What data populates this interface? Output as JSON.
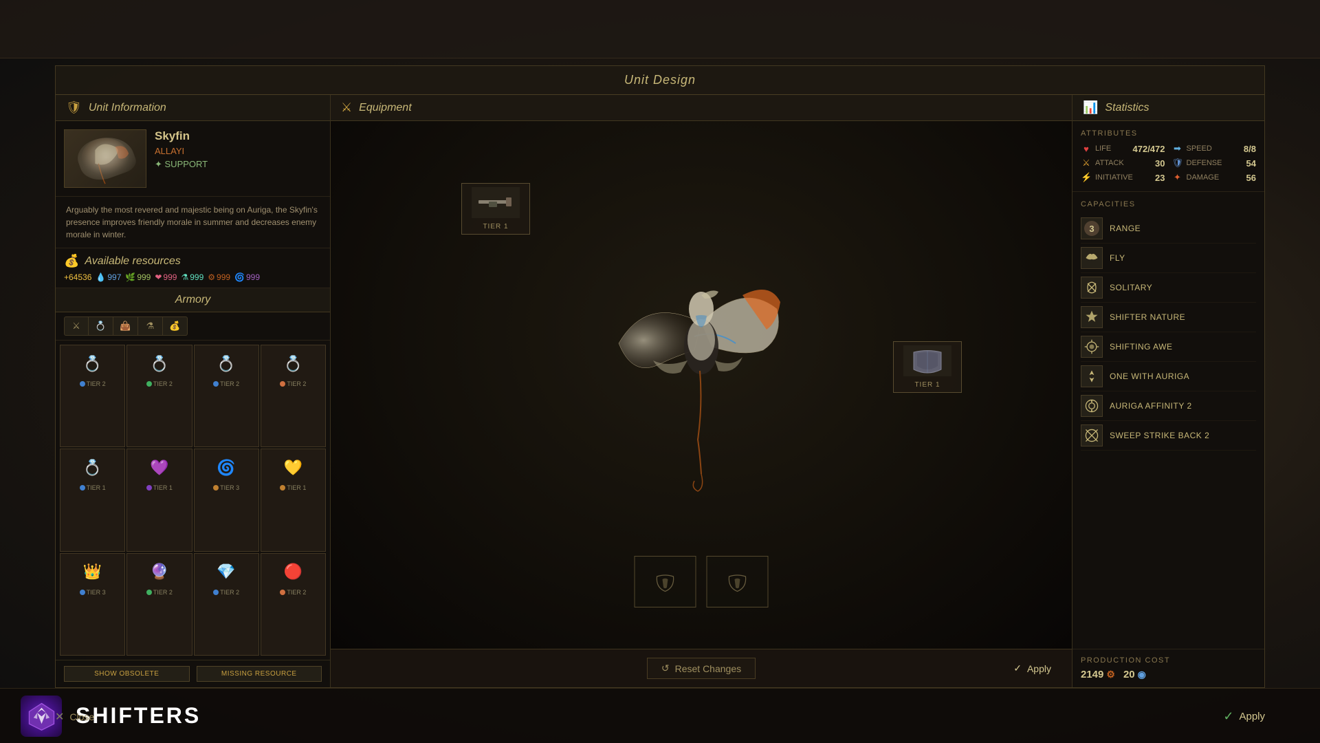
{
  "window": {
    "title": "Unit Design"
  },
  "topBar": {
    "text": ""
  },
  "unitInfo": {
    "header": "Unit Information",
    "name": "Skyfin",
    "faction": "ALLAYI",
    "role": "✦ SUPPORT",
    "description": "Arguably the most revered and majestic being on Auriga, the Skyfin's presence improves friendly morale in summer and decreases enemy morale in winter."
  },
  "resources": {
    "header": "Available resources",
    "gold": "+64536",
    "dust": "997",
    "food": "999",
    "influence": "999",
    "science": "999",
    "industry": "999",
    "wild": "999"
  },
  "armory": {
    "header": "Armory",
    "filters": [
      "⚔",
      "💍",
      "👜",
      "⚗",
      "💰"
    ],
    "items": [
      {
        "tier": "TIER 2",
        "tierColor": "blue",
        "icon": "💍"
      },
      {
        "tier": "TIER 2",
        "tierColor": "green",
        "icon": "💍"
      },
      {
        "tier": "TIER 2",
        "tierColor": "blue",
        "icon": "💍"
      },
      {
        "tier": "TIER 2",
        "tierColor": "orange",
        "icon": "💍"
      },
      {
        "tier": "TIER 1",
        "tierColor": "blue",
        "icon": "💍"
      },
      {
        "tier": "TIER 1",
        "tierColor": "purple",
        "icon": "💜"
      },
      {
        "tier": "TIER 3",
        "tierColor": "gold",
        "icon": "💍"
      },
      {
        "tier": "TIER 1",
        "tierColor": "gold",
        "icon": "💛"
      },
      {
        "tier": "TIER 3",
        "tierColor": "blue",
        "icon": "👑"
      },
      {
        "tier": "TIER 2",
        "tierColor": "green",
        "icon": "🔮"
      },
      {
        "tier": "TIER 2",
        "tierColor": "blue",
        "icon": "💎"
      },
      {
        "tier": "TIER 2",
        "tierColor": "orange",
        "icon": "🔴"
      }
    ],
    "showObsolete": "SHOW OBSOLETE",
    "missingResource": "MISSING RESOURCE"
  },
  "equipment": {
    "header": "Equipment",
    "slot1": {
      "tier": "TIER 1",
      "icon": "🔫"
    },
    "slot2": {
      "tier": "TIER 1",
      "icon": "🎽"
    },
    "groundSlot1": "🎒",
    "groundSlot2": "🎒"
  },
  "bottomBar": {
    "resetLabel": "Reset Changes",
    "applyLabel": "Apply",
    "closeLabel": "Close",
    "factionName": "SHIFTERS"
  },
  "statistics": {
    "header": "Statistics",
    "attributes": {
      "label": "ATTRIBUTES",
      "life": {
        "name": "LIFE",
        "value": "472/472"
      },
      "speed": {
        "name": "SPEED",
        "value": "8/8"
      },
      "attack": {
        "name": "ATTACK",
        "value": "30"
      },
      "defense": {
        "name": "DEFENSE",
        "value": "54"
      },
      "initiative": {
        "name": "INITIATIVE",
        "value": "23"
      },
      "damage": {
        "name": "DAMAGE",
        "value": "56"
      }
    },
    "capacities": {
      "label": "CAPACITIES",
      "items": [
        {
          "name": "RANGE",
          "icon": "③",
          "type": "badge"
        },
        {
          "name": "FLY",
          "icon": "🦅",
          "type": "icon"
        },
        {
          "name": "SOLITARY",
          "icon": "❄",
          "type": "icon"
        },
        {
          "name": "SHIFTER NATURE",
          "icon": "✦",
          "type": "icon"
        },
        {
          "name": "SHIFTING AWE",
          "icon": "⚙",
          "type": "icon"
        },
        {
          "name": "ONE WITH AURIGA",
          "icon": "◆",
          "type": "icon"
        },
        {
          "name": "AURIGA AFFINITY 2",
          "icon": "◎",
          "type": "icon"
        },
        {
          "name": "SWEEP STRIKE BACK 2",
          "icon": "⊗",
          "type": "icon"
        }
      ]
    },
    "productionCost": {
      "label": "PRODUCTION COST",
      "industry": "2149",
      "dust": "20"
    }
  }
}
